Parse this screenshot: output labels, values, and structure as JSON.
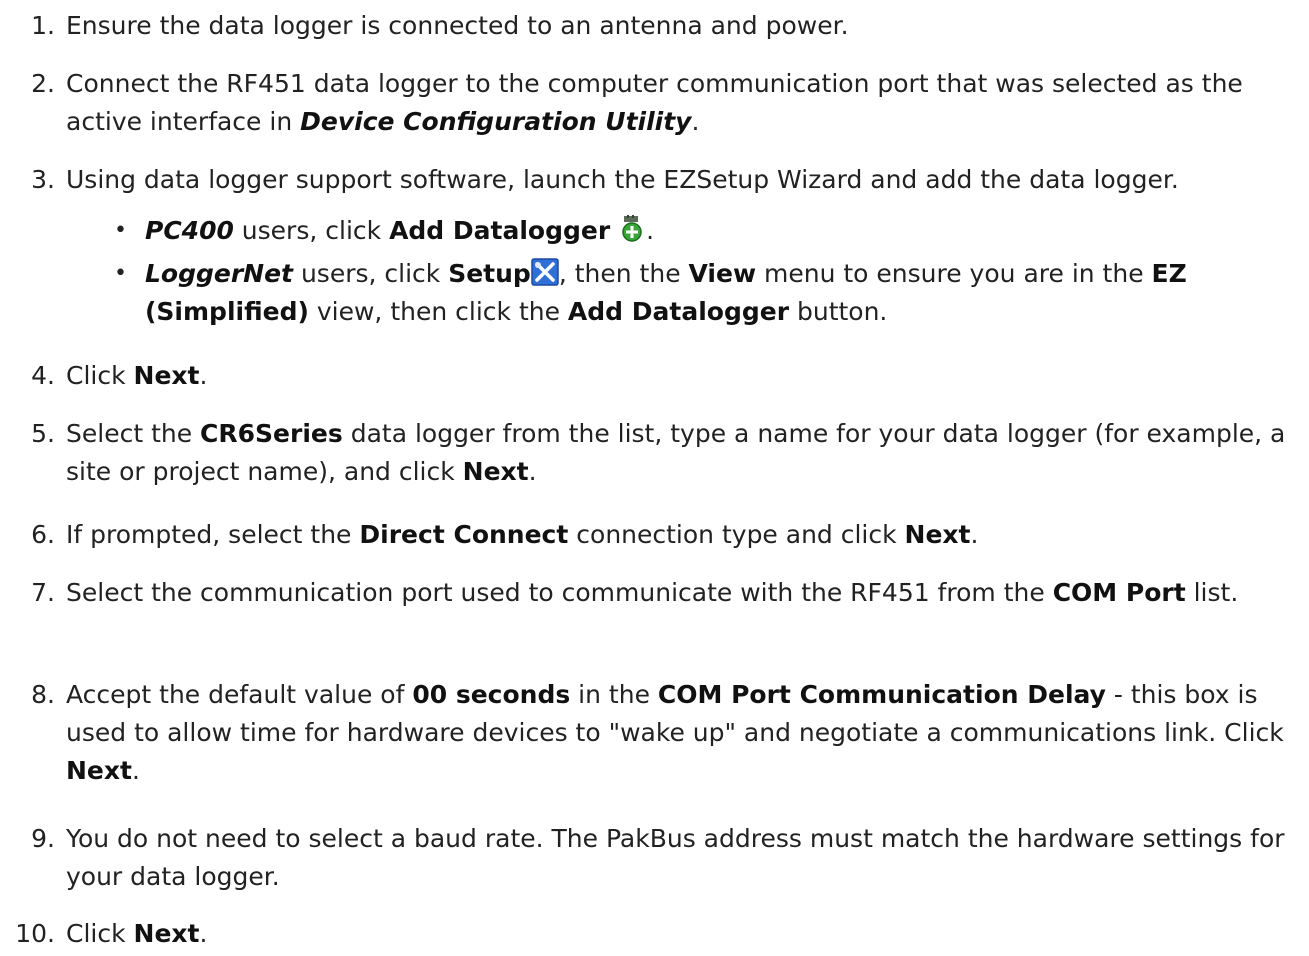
{
  "steps": [
    {
      "num": "1.",
      "parts": [
        "Ensure the data logger is connected to an antenna and power."
      ]
    },
    {
      "num": "2.",
      "parts": [
        "Connect the RF451 data logger to the computer communication port that was selected as the active interface in ",
        "Device Configuration Utility",
        "."
      ]
    },
    {
      "num": "3.",
      "parts": [
        "Using data logger support software, launch the EZSetup Wizard and add the data logger."
      ]
    },
    {
      "num": "4.",
      "parts": [
        "Click ",
        "Next",
        "."
      ]
    },
    {
      "num": "5.",
      "parts": [
        "Select the ",
        "CR6Series",
        " data logger from the list, type a name for your data logger (for example, a site or project name), and click ",
        "Next",
        "."
      ]
    },
    {
      "num": "6.",
      "parts": [
        "If prompted, select the ",
        "Direct Connect",
        " connection type and click ",
        "Next",
        "."
      ]
    },
    {
      "num": "7.",
      "parts": [
        "Select the communication port used to communicate with the RF451 from the ",
        "COM Port",
        " list."
      ]
    },
    {
      "num": "8.",
      "parts": [
        "Accept the default value of ",
        "00 seconds",
        " in the ",
        "COM Port Communication Delay",
        " - this box is used to allow time for hardware devices to \"wake up\" and negotiate a communications link. Click ",
        "Next",
        "."
      ]
    },
    {
      "num": "9.",
      "parts": [
        "You do not need to select a baud rate. The PakBus address must match the hardware settings for your data logger."
      ]
    },
    {
      "num": "10.",
      "parts": [
        "Click ",
        "Next",
        "."
      ]
    }
  ],
  "substeps": [
    {
      "bullet": "•",
      "parts": [
        "PC400",
        " users, click ",
        "Add Datalogger",
        "",
        "."
      ],
      "icon": "add-datalogger-icon"
    },
    {
      "bullet": "•",
      "parts": [
        "LoggerNet",
        " users, click ",
        "Setup",
        "",
        ", then the ",
        "View",
        " menu to ensure you are in the ",
        "EZ",
        " ",
        "(Simplified)",
        " view, then click the ",
        "Add Datalogger",
        " button."
      ],
      "icon": "setup-icon"
    }
  ]
}
